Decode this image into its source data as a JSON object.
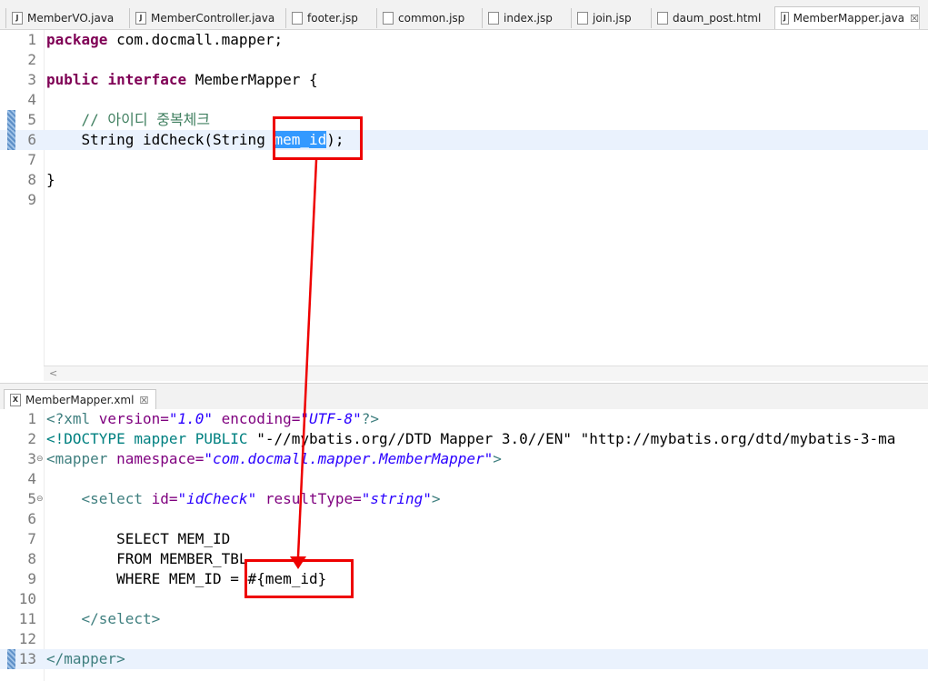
{
  "tabs": [
    {
      "label": "MemberVO.java",
      "icon": "J"
    },
    {
      "label": "MemberController.java",
      "icon": "J"
    },
    {
      "label": "footer.jsp",
      "icon": ""
    },
    {
      "label": "common.jsp",
      "icon": ""
    },
    {
      "label": "index.jsp",
      "icon": ""
    },
    {
      "label": "join.jsp",
      "icon": ""
    },
    {
      "label": "daum_post.html",
      "icon": ""
    },
    {
      "label": "MemberMapper.java",
      "icon": "J",
      "close": "☒"
    }
  ],
  "java_editor": {
    "line_numbers": [
      "1",
      "2",
      "3",
      "4",
      "5",
      "6",
      "7",
      "8",
      "9"
    ],
    "package_kw": "package",
    "package_name": " com.docmall.mapper;",
    "public_kw": "public",
    "interface_kw": "interface",
    "interface_name": " MemberMapper {",
    "comment": "// 아이디 중복체크",
    "method_prefix": "String idCheck(String ",
    "param": "mem_id",
    "method_suffix": ");",
    "close_brace": "}"
  },
  "xml_tab": {
    "label": "MemberMapper.xml",
    "icon": "X",
    "close": "☒"
  },
  "xml_editor": {
    "line_numbers": [
      "1",
      "2",
      "3",
      "4",
      "5",
      "6",
      "7",
      "8",
      "9",
      "10",
      "11",
      "12",
      "13"
    ],
    "fold_marker": "⊖",
    "l1": {
      "open": "<?xml ",
      "version_attr": "version=",
      "version_val": "\"1.0\"",
      "enc_attr": " encoding=",
      "enc_val": "\"UTF-8\"",
      "close": "?>"
    },
    "l2": {
      "doctype": "<!DOCTYPE mapper PUBLIC ",
      "public_id": "\"-//mybatis.org//DTD Mapper 3.0//EN\"",
      "system_id": " \"http://mybatis.org/dtd/mybatis-3-ma"
    },
    "l3": {
      "open": "<mapper ",
      "attr": "namespace=",
      "val": "\"com.docmall.mapper.MemberMapper\"",
      "close": ">"
    },
    "l5": {
      "open": "<select ",
      "id_attr": "id=",
      "id_val": "\"idCheck\"",
      "rt_attr": " resultType=",
      "rt_val": "\"string\"",
      "close": ">"
    },
    "l7": "SELECT MEM_ID",
    "l8": "FROM MEMBER_TBL",
    "l9": "WHERE MEM_ID = #{mem_id}",
    "l11": "</select>",
    "l13": "</mapper>"
  },
  "colors": {
    "annotation": "#ee0000",
    "selection": "#3399ff",
    "current_line": "#eaf2fd"
  }
}
